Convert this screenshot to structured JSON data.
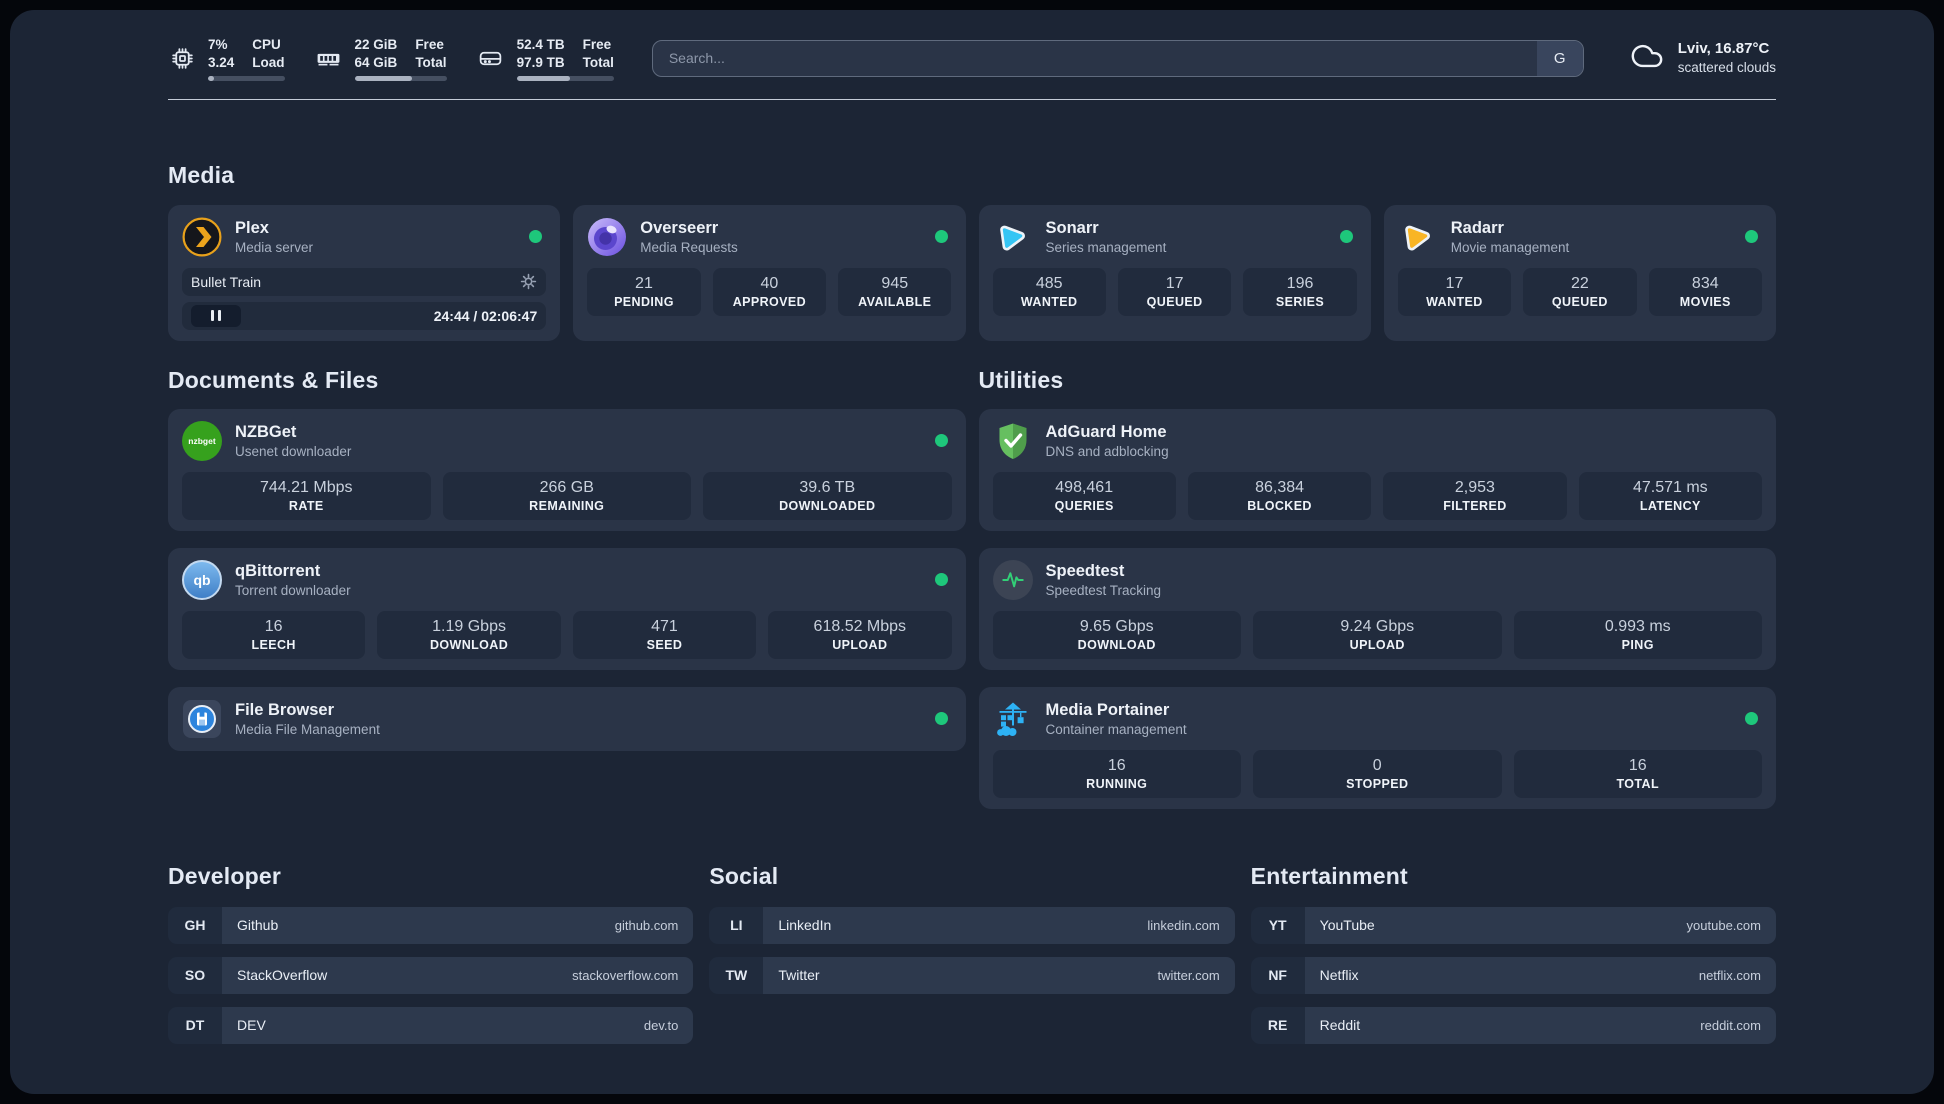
{
  "colors": {
    "status_online": "#1ec77b",
    "accent_blue": "#2db2f5",
    "background": "#1c2535",
    "card": "#2a3447"
  },
  "header": {
    "stats": [
      {
        "icon": "cpu-icon",
        "value_top": "7%",
        "value_bottom": "3.24",
        "label_top": "CPU",
        "label_bottom": "Load",
        "progress": 8
      },
      {
        "icon": "ram-icon",
        "value_top": "22 GiB",
        "value_bottom": "64 GiB",
        "label_top": "Free",
        "label_bottom": "Total",
        "progress": 62
      },
      {
        "icon": "disk-icon",
        "value_top": "52.4 TB",
        "value_bottom": "97.9 TB",
        "label_top": "Free",
        "label_bottom": "Total",
        "progress": 55
      }
    ],
    "search": {
      "placeholder": "Search...",
      "button": "G"
    },
    "weather": {
      "location": "Lviv, 16.87°C",
      "condition": "scattered clouds"
    }
  },
  "media": {
    "title": "Media",
    "cards": [
      {
        "name": "Plex",
        "desc": "Media server",
        "icon": "plex",
        "status": "online",
        "player": {
          "title": "Bullet Train",
          "time": "24:44 / 02:06:47"
        }
      },
      {
        "name": "Overseerr",
        "desc": "Media Requests",
        "icon": "overseerr",
        "status": "online",
        "stats": [
          {
            "value": "21",
            "label": "PENDING"
          },
          {
            "value": "40",
            "label": "APPROVED"
          },
          {
            "value": "945",
            "label": "AVAILABLE"
          }
        ]
      },
      {
        "name": "Sonarr",
        "desc": "Series management",
        "icon": "sonarr",
        "status": "online",
        "stats": [
          {
            "value": "485",
            "label": "WANTED"
          },
          {
            "value": "17",
            "label": "QUEUED"
          },
          {
            "value": "196",
            "label": "SERIES"
          }
        ]
      },
      {
        "name": "Radarr",
        "desc": "Movie management",
        "icon": "radarr",
        "status": "online",
        "stats": [
          {
            "value": "17",
            "label": "WANTED"
          },
          {
            "value": "22",
            "label": "QUEUED"
          },
          {
            "value": "834",
            "label": "MOVIES"
          }
        ]
      }
    ]
  },
  "columns": [
    {
      "title": "Documents & Files",
      "cards": [
        {
          "name": "NZBGet",
          "desc": "Usenet downloader",
          "icon": "nzbget",
          "status": "online",
          "stats": [
            {
              "value": "744.21 Mbps",
              "label": "RATE"
            },
            {
              "value": "266 GB",
              "label": "REMAINING"
            },
            {
              "value": "39.6 TB",
              "label": "DOWNLOADED"
            }
          ]
        },
        {
          "name": "qBittorrent",
          "desc": "Torrent downloader",
          "icon": "qbittorrent",
          "status": "online",
          "stats": [
            {
              "value": "16",
              "label": "LEECH"
            },
            {
              "value": "1.19 Gbps",
              "label": "DOWNLOAD"
            },
            {
              "value": "471",
              "label": "SEED"
            },
            {
              "value": "618.52 Mbps",
              "label": "UPLOAD"
            }
          ]
        },
        {
          "name": "File Browser",
          "desc": "Media File Management",
          "icon": "filebrowser",
          "status": "online"
        }
      ]
    },
    {
      "title": "Utilities",
      "cards": [
        {
          "name": "AdGuard Home",
          "desc": "DNS and adblocking",
          "icon": "adguard",
          "status": "none",
          "stats": [
            {
              "value": "498,461",
              "label": "QUERIES"
            },
            {
              "value": "86,384",
              "label": "BLOCKED"
            },
            {
              "value": "2,953",
              "label": "FILTERED"
            },
            {
              "value": "47.571 ms",
              "label": "LATENCY"
            }
          ]
        },
        {
          "name": "Speedtest",
          "desc": "Speedtest Tracking",
          "icon": "speedtest",
          "status": "none",
          "stats": [
            {
              "value": "9.65 Gbps",
              "label": "DOWNLOAD"
            },
            {
              "value": "9.24 Gbps",
              "label": "UPLOAD"
            },
            {
              "value": "0.993 ms",
              "label": "PING"
            }
          ]
        },
        {
          "name": "Media Portainer",
          "desc": "Container management",
          "icon": "portainer",
          "status": "online",
          "stats": [
            {
              "value": "16",
              "label": "RUNNING"
            },
            {
              "value": "0",
              "label": "STOPPED"
            },
            {
              "value": "16",
              "label": "TOTAL"
            }
          ]
        }
      ]
    }
  ],
  "link_groups": [
    {
      "title": "Developer",
      "links": [
        {
          "abbr": "GH",
          "name": "Github",
          "url": "github.com"
        },
        {
          "abbr": "SO",
          "name": "StackOverflow",
          "url": "stackoverflow.com"
        },
        {
          "abbr": "DT",
          "name": "DEV",
          "url": "dev.to"
        }
      ]
    },
    {
      "title": "Social",
      "links": [
        {
          "abbr": "LI",
          "name": "LinkedIn",
          "url": "linkedin.com"
        },
        {
          "abbr": "TW",
          "name": "Twitter",
          "url": "twitter.com"
        }
      ]
    },
    {
      "title": "Entertainment",
      "links": [
        {
          "abbr": "YT",
          "name": "YouTube",
          "url": "youtube.com"
        },
        {
          "abbr": "NF",
          "name": "Netflix",
          "url": "netflix.com"
        },
        {
          "abbr": "RE",
          "name": "Reddit",
          "url": "reddit.com"
        }
      ]
    }
  ]
}
